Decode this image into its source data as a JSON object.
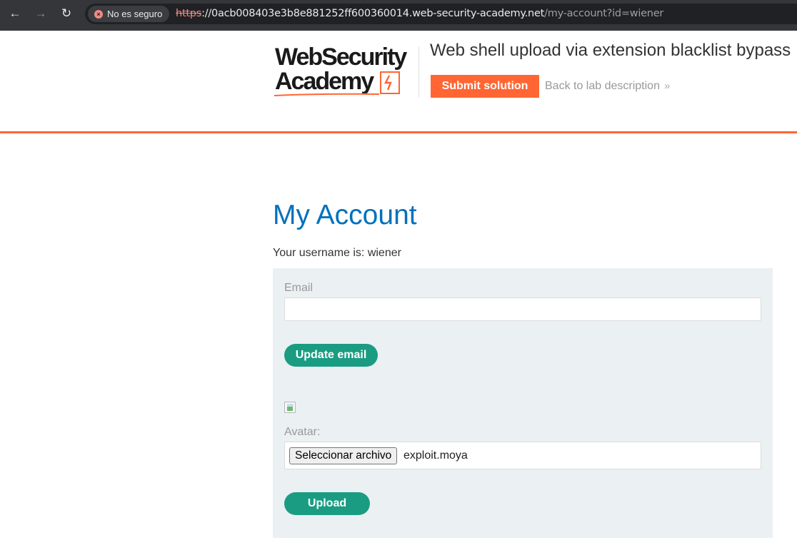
{
  "browser": {
    "back_icon": "←",
    "forward_icon": "→",
    "reload_icon": "↻",
    "security_icon": "×",
    "security_label": "No es seguro",
    "url_scheme": "https",
    "url_host": "://0acb008403e3b8e881252ff600360014.web-security-academy.net",
    "url_path": "/my-account?id=wiener"
  },
  "header": {
    "logo_line1": "WebSecurity",
    "logo_line2": "Academy",
    "lab_title": "Web shell upload via extension blacklist bypass",
    "submit_label": "Submit solution",
    "back_label": "Back to lab description",
    "back_chevron": "»"
  },
  "colors": {
    "accent": "#ff6633",
    "title_blue": "#0071bc",
    "button_green": "#1a9c82",
    "panel_bg": "#ebf0f2"
  },
  "account": {
    "title": "My Account",
    "username_line": "Your username is: wiener",
    "email_label": "Email",
    "email_value": "",
    "update_email_label": "Update email",
    "avatar_label": "Avatar:",
    "choose_file_label": "Seleccionar archivo",
    "chosen_file": "exploit.moya",
    "upload_label": "Upload"
  }
}
